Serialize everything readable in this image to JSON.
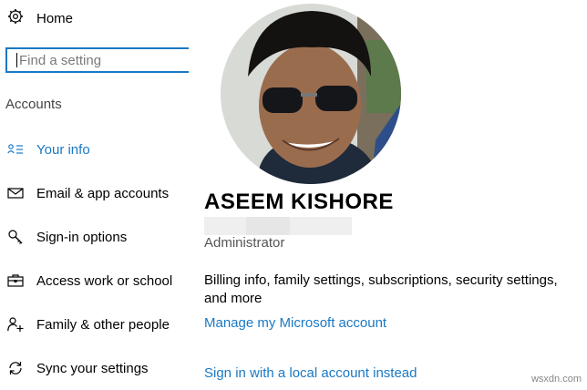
{
  "sidebar": {
    "home_label": "Home",
    "search_placeholder": "Find a setting",
    "section_title": "Accounts",
    "items": [
      {
        "label": "Your info",
        "icon": "person-card-icon",
        "active": true
      },
      {
        "label": "Email & app accounts",
        "icon": "mail-icon",
        "active": false
      },
      {
        "label": "Sign-in options",
        "icon": "key-icon",
        "active": false
      },
      {
        "label": "Access work or school",
        "icon": "briefcase-icon",
        "active": false
      },
      {
        "label": "Family & other people",
        "icon": "add-person-icon",
        "active": false
      },
      {
        "label": "Sync your settings",
        "icon": "sync-icon",
        "active": false
      }
    ]
  },
  "profile": {
    "name": "ASEEM KISHORE",
    "role": "Administrator",
    "description": "Billing info, family settings, subscriptions, security settings, and more",
    "manage_link": "Manage my Microsoft account",
    "local_account_link": "Sign in with a local account instead"
  },
  "colors": {
    "accent": "#1a79c4",
    "text": "#000000",
    "muted": "#555555"
  },
  "watermark": "wsxdn.com"
}
